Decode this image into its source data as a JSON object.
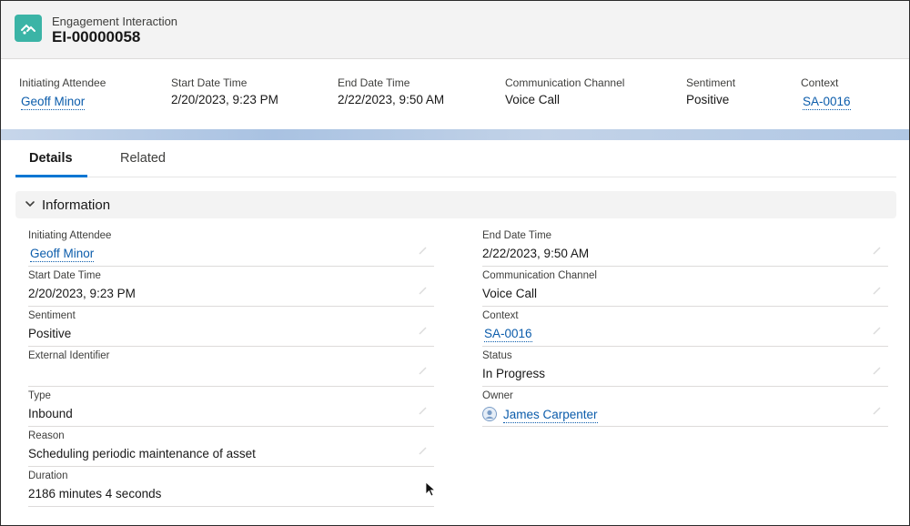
{
  "header": {
    "object_label": "Engagement Interaction",
    "record_name": "EI-00000058"
  },
  "highlights": [
    {
      "label": "Initiating Attendee",
      "value": "Geoff Minor",
      "link": true
    },
    {
      "label": "Start Date Time",
      "value": "2/20/2023, 9:23 PM",
      "link": false
    },
    {
      "label": "End Date Time",
      "value": "2/22/2023, 9:50 AM",
      "link": false
    },
    {
      "label": "Communication Channel",
      "value": "Voice Call",
      "link": false
    },
    {
      "label": "Sentiment",
      "value": "Positive",
      "link": false
    },
    {
      "label": "Context",
      "value": "SA-0016",
      "link": true
    }
  ],
  "tabs": {
    "details": "Details",
    "related": "Related"
  },
  "section": {
    "title": "Information"
  },
  "fields_left": [
    {
      "label": "Initiating Attendee",
      "value": "Geoff Minor"
    },
    {
      "label": "Start Date Time",
      "value": "2/20/2023, 9:23 PM"
    },
    {
      "label": "Sentiment",
      "value": "Positive"
    },
    {
      "label": "External Identifier",
      "value": ""
    },
    {
      "label": "Type",
      "value": "Inbound"
    },
    {
      "label": "Reason",
      "value": "Scheduling periodic maintenance of asset"
    },
    {
      "label": "Duration",
      "value": "2186 minutes 4 seconds"
    }
  ],
  "fields_right": [
    {
      "label": "End Date Time",
      "value": "2/22/2023, 9:50 AM"
    },
    {
      "label": "Communication Channel",
      "value": "Voice Call"
    },
    {
      "label": "Context",
      "value": "SA-0016"
    },
    {
      "label": "Status",
      "value": "In Progress"
    },
    {
      "label": "Owner",
      "value": "James Carpenter"
    }
  ],
  "colors": {
    "brand_icon": "#3bb4a6",
    "link": "#0b5cab",
    "active_tab": "#0176d3"
  },
  "icons": {
    "record": "engagement-interaction-icon",
    "edit": "pencil-icon",
    "owner": "user-avatar-icon",
    "section": "chevron-down-icon"
  }
}
